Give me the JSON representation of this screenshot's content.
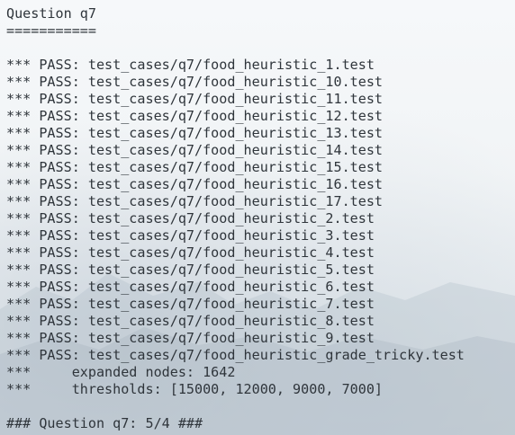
{
  "terminal": {
    "lines": [
      "Question q7",
      "===========",
      "",
      "*** PASS: test_cases/q7/food_heuristic_1.test",
      "*** PASS: test_cases/q7/food_heuristic_10.test",
      "*** PASS: test_cases/q7/food_heuristic_11.test",
      "*** PASS: test_cases/q7/food_heuristic_12.test",
      "*** PASS: test_cases/q7/food_heuristic_13.test",
      "*** PASS: test_cases/q7/food_heuristic_14.test",
      "*** PASS: test_cases/q7/food_heuristic_15.test",
      "*** PASS: test_cases/q7/food_heuristic_16.test",
      "*** PASS: test_cases/q7/food_heuristic_17.test",
      "*** PASS: test_cases/q7/food_heuristic_2.test",
      "*** PASS: test_cases/q7/food_heuristic_3.test",
      "*** PASS: test_cases/q7/food_heuristic_4.test",
      "*** PASS: test_cases/q7/food_heuristic_5.test",
      "*** PASS: test_cases/q7/food_heuristic_6.test",
      "*** PASS: test_cases/q7/food_heuristic_7.test",
      "*** PASS: test_cases/q7/food_heuristic_8.test",
      "*** PASS: test_cases/q7/food_heuristic_9.test",
      "*** PASS: test_cases/q7/food_heuristic_grade_tricky.test",
      "***     expanded nodes: 1642",
      "***     thresholds: [15000, 12000, 9000, 7000]",
      "",
      "### Question q7: 5/4 ###"
    ]
  }
}
